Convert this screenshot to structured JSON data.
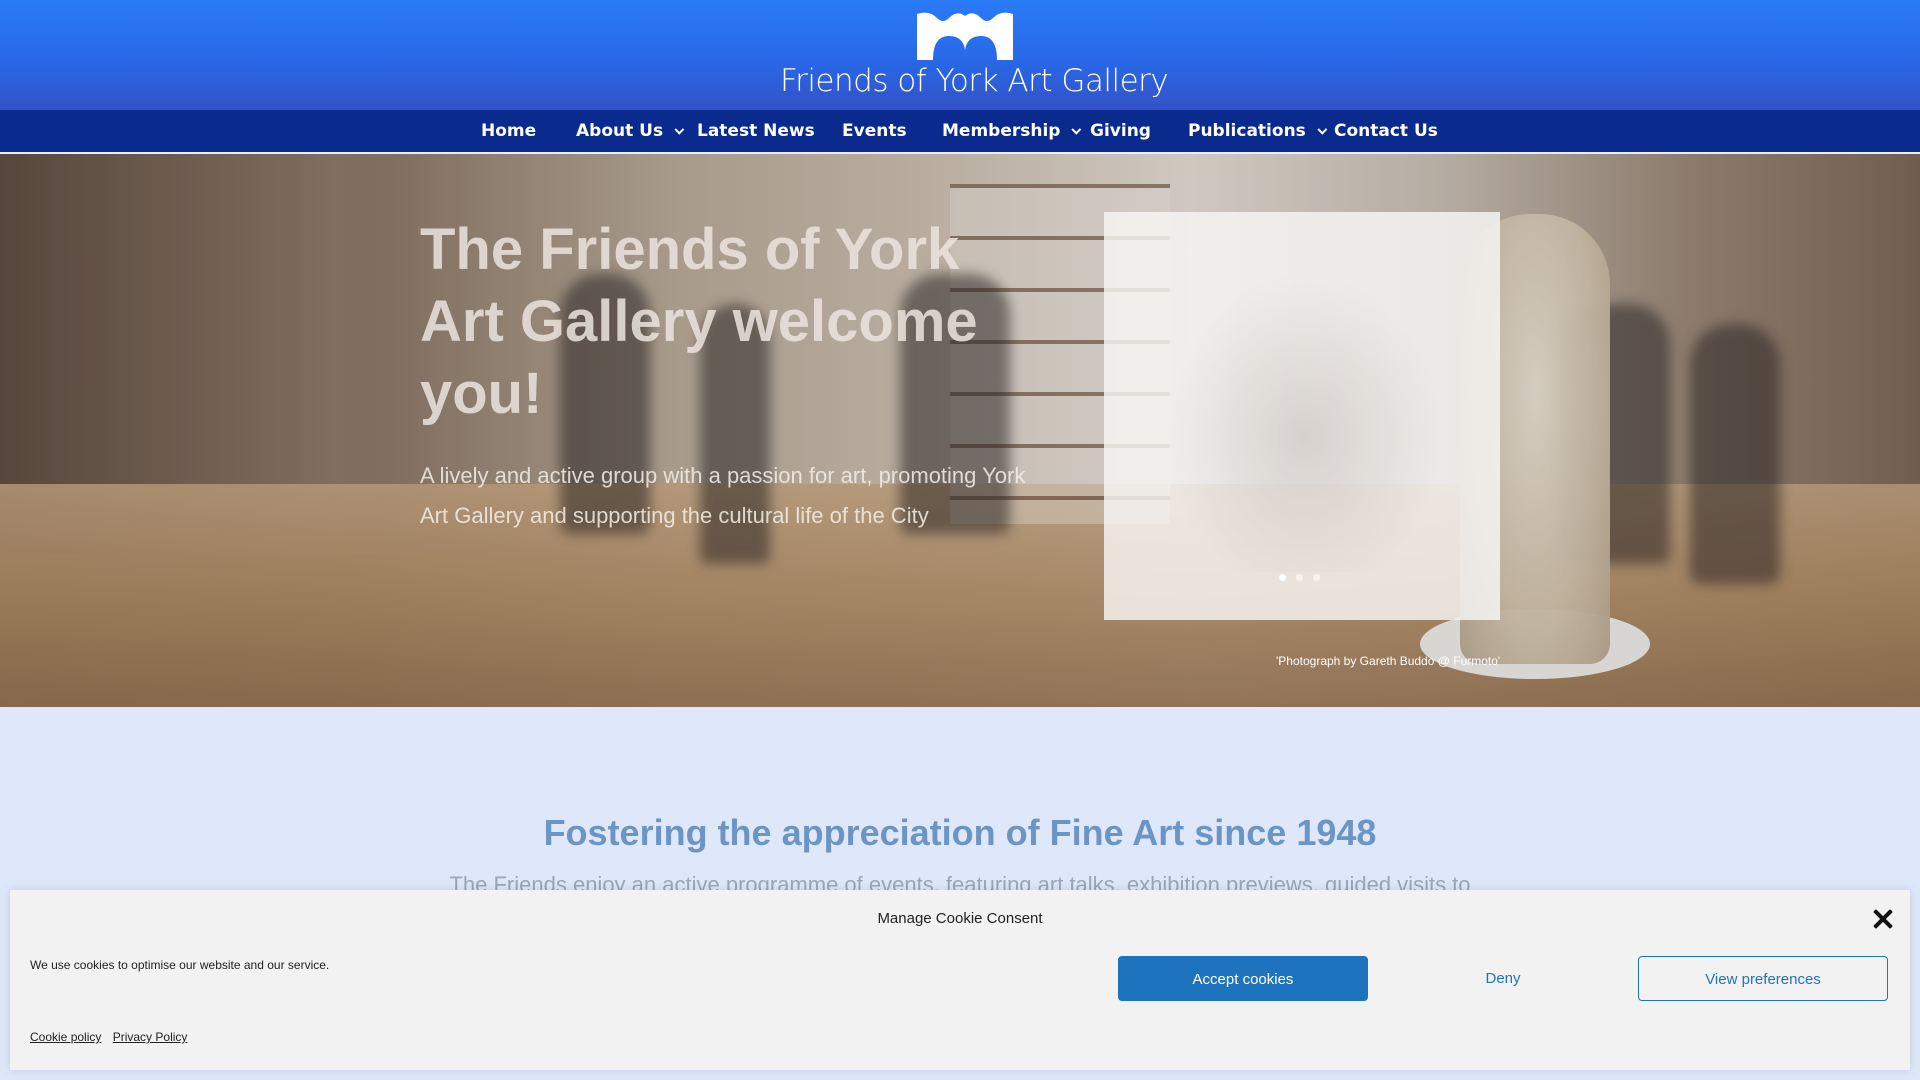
{
  "header": {
    "logo_text": "Friends of York Art Gallery",
    "brand_color": "#2a7bf7",
    "nav_color": "#0a2a8e"
  },
  "nav": {
    "items": [
      {
        "label": "Home",
        "dropdown": false
      },
      {
        "label": "About Us",
        "dropdown": true
      },
      {
        "label": "Latest News",
        "dropdown": false
      },
      {
        "label": "Events",
        "dropdown": false
      },
      {
        "label": "Membership",
        "dropdown": true
      },
      {
        "label": "Giving",
        "dropdown": false
      },
      {
        "label": "Publications",
        "dropdown": true
      },
      {
        "label": "Contact Us",
        "dropdown": false
      }
    ]
  },
  "hero": {
    "title": "The Friends of York Art Gallery welcome you!",
    "subtitle": "A lively and active group with a passion for art, promoting York Art Gallery and supporting the cultural life of the City",
    "photo_credit": "'Photograph by Gareth Buddo @ Furmoto'",
    "slider": {
      "slide_count": 3,
      "active_slide": 1
    }
  },
  "content": {
    "title": "Fostering the appreciation of Fine Art since 1948",
    "text": "The Friends enjoy an active programme of events, featuring art talks, exhibition previews, guided visits to"
  },
  "cookie": {
    "title": "Manage Cookie Consent",
    "message": "We use cookies to optimise our website and our service.",
    "accept_label": "Accept cookies",
    "deny_label": "Deny",
    "prefs_label": "View preferences",
    "links": [
      "Cookie policy",
      "Privacy Policy"
    ],
    "accent_color": "#1e73be"
  }
}
